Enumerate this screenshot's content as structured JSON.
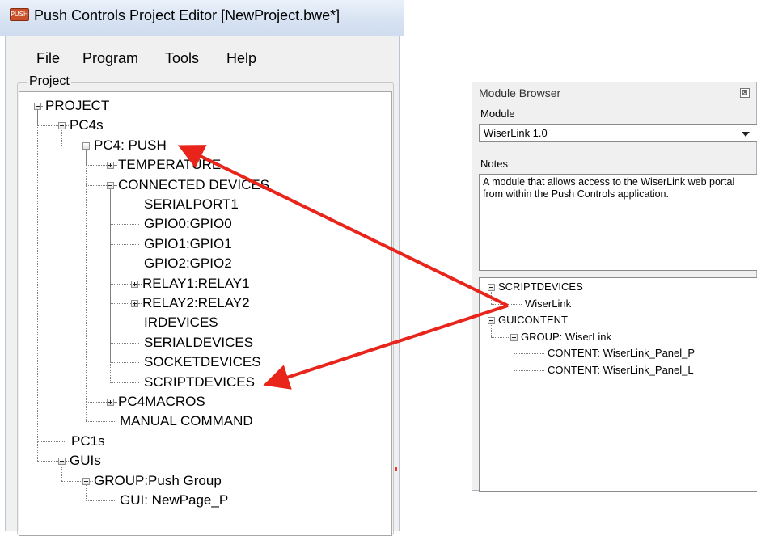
{
  "window": {
    "title": "Push Controls Project Editor [NewProject.bwe*]",
    "app_icon_text": "PUSH"
  },
  "menu": [
    "File",
    "Program",
    "Tools",
    "Help"
  ],
  "project_group_label": "Project",
  "project_tree": [
    {
      "label": "PROJECT",
      "depth": 0,
      "expander": "minus"
    },
    {
      "label": "PC4s",
      "depth": 1,
      "expander": "minus"
    },
    {
      "label": "PC4: PUSH",
      "depth": 2,
      "expander": "minus"
    },
    {
      "label": "TEMPERATURE",
      "depth": 3,
      "expander": "plus"
    },
    {
      "label": "CONNECTED DEVICES",
      "depth": 3,
      "expander": "minus"
    },
    {
      "label": "SERIALPORT1",
      "depth": 4,
      "expander": "none"
    },
    {
      "label": "GPIO0:GPIO0",
      "depth": 4,
      "expander": "none"
    },
    {
      "label": "GPIO1:GPIO1",
      "depth": 4,
      "expander": "none"
    },
    {
      "label": "GPIO2:GPIO2",
      "depth": 4,
      "expander": "none"
    },
    {
      "label": "RELAY1:RELAY1",
      "depth": 4,
      "expander": "plus"
    },
    {
      "label": "RELAY2:RELAY2",
      "depth": 4,
      "expander": "plus"
    },
    {
      "label": "IRDEVICES",
      "depth": 4,
      "expander": "none"
    },
    {
      "label": "SERIALDEVICES",
      "depth": 4,
      "expander": "none"
    },
    {
      "label": "SOCKETDEVICES",
      "depth": 4,
      "expander": "none"
    },
    {
      "label": "SCRIPTDEVICES",
      "depth": 4,
      "expander": "none"
    },
    {
      "label": "PC4MACROS",
      "depth": 3,
      "expander": "plus"
    },
    {
      "label": "MANUAL COMMAND",
      "depth": 3,
      "expander": "none"
    },
    {
      "label": "PC1s",
      "depth": 1,
      "expander": "none"
    },
    {
      "label": "GUIs",
      "depth": 1,
      "expander": "minus"
    },
    {
      "label": "GROUP:Push Group",
      "depth": 2,
      "expander": "minus"
    },
    {
      "label": "GUI: NewPage_P",
      "depth": 3,
      "expander": "none"
    }
  ],
  "module_browser": {
    "title": "Module Browser",
    "close_glyph": "⊠",
    "module_label": "Module",
    "module_selected": "WiserLink 1.0",
    "notes_label": "Notes",
    "notes_text": "A module that allows access to the WiserLink web portal from within the Push Controls application.",
    "tree": [
      {
        "label": "SCRIPTDEVICES",
        "depth": 0,
        "expander": "minus"
      },
      {
        "label": "WiserLink",
        "depth": 1,
        "expander": "none"
      },
      {
        "label": "GUICONTENT",
        "depth": 0,
        "expander": "minus"
      },
      {
        "label": "GROUP: WiserLink",
        "depth": 1,
        "expander": "minus"
      },
      {
        "label": "CONTENT: WiserLink_Panel_P",
        "depth": 2,
        "expander": "none"
      },
      {
        "label": "CONTENT: WiserLink_Panel_L",
        "depth": 2,
        "expander": "none"
      }
    ]
  },
  "annotation": {
    "arrow_color": "#e8241b",
    "from": "WiserLink",
    "to": [
      "PC4: PUSH",
      "SCRIPTDEVICES"
    ]
  }
}
